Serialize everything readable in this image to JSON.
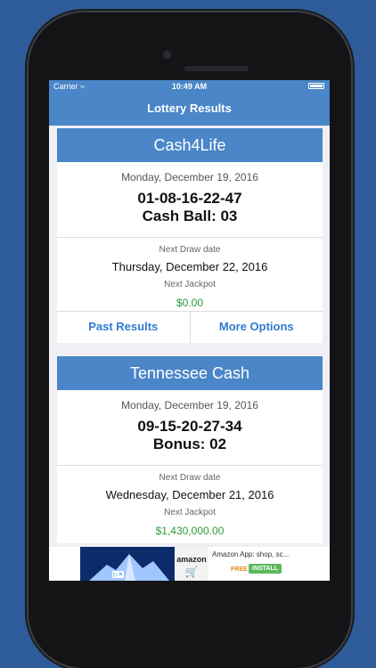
{
  "status_bar": {
    "carrier": "Carrier",
    "time": "10:49 AM"
  },
  "nav": {
    "title": "Lottery Results"
  },
  "cards": [
    {
      "name": "Cash4Life",
      "date": "Monday, December 19, 2016",
      "numbers": "01-08-16-22-47",
      "extra": "Cash Ball: 03",
      "next_label": "Next Draw date",
      "next_date": "Thursday, December 22, 2016",
      "jackpot_label": "Next Jackpot",
      "jackpot": "$0.00",
      "actions": [
        "Past Results",
        "More Options"
      ]
    },
    {
      "name": "Tennessee Cash",
      "date": "Monday, December 19, 2016",
      "numbers": "09-15-20-27-34",
      "extra": "Bonus: 02",
      "next_label": "Next Draw date",
      "next_date": "Wednesday, December 21, 2016",
      "jackpot_label": "Next Jackpot",
      "jackpot": "$1,430,000.00"
    }
  ],
  "ad": {
    "logo": "amazon",
    "text": "Amazon App: shop, sc...",
    "free": "FREE",
    "install": "INSTALL"
  },
  "colors": {
    "background": "#2e5c9a",
    "accent": "#4a86c8",
    "jackpot": "#2e9a3a",
    "link": "#2f7bd0"
  }
}
